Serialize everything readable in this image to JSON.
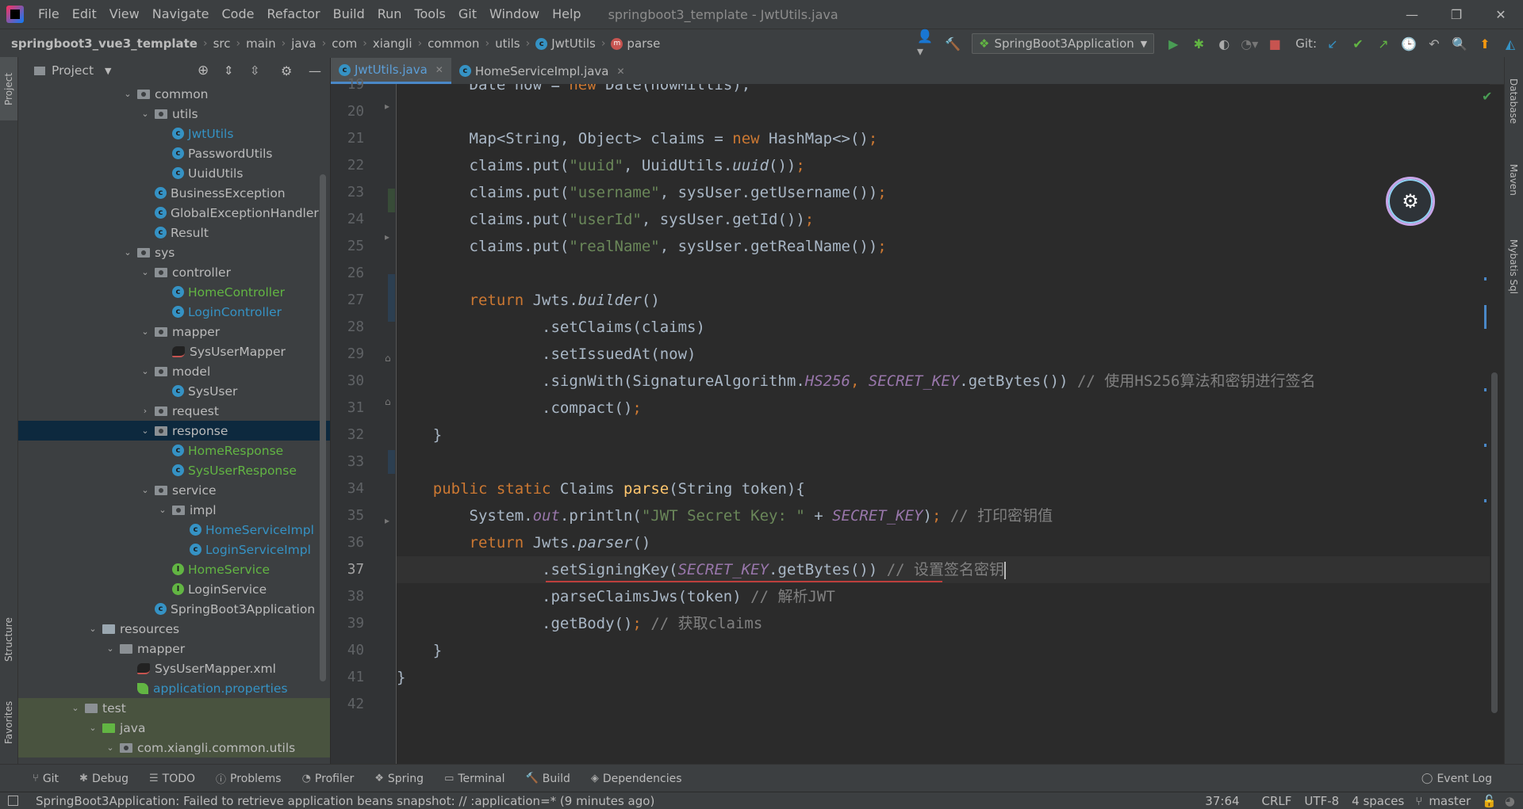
{
  "menubar": {
    "items": [
      "File",
      "Edit",
      "View",
      "Navigate",
      "Code",
      "Refactor",
      "Build",
      "Run",
      "Tools",
      "Git",
      "Window",
      "Help"
    ],
    "title": "springboot3_template - JwtUtils.java"
  },
  "breadcrumbs": [
    "springboot3_vue3_template",
    "src",
    "main",
    "java",
    "com",
    "xiangli",
    "common",
    "utils",
    "JwtUtils",
    "parse"
  ],
  "toolbar": {
    "run_config": "SpringBoot3Application",
    "git_label": "Git:"
  },
  "left_stripe": {
    "project": "Project",
    "structure": "Structure",
    "favorites": "Favorites"
  },
  "right_stripe": {
    "database": "Database",
    "maven": "Maven",
    "mybatis": "Mybatis Sql"
  },
  "project_panel": {
    "title": "Project",
    "tree": [
      {
        "label": "common",
        "type": "package",
        "indent": 0,
        "open": true
      },
      {
        "label": "utils",
        "type": "package",
        "indent": 1,
        "open": true
      },
      {
        "label": "JwtUtils",
        "type": "class",
        "indent": 2,
        "color": "blue"
      },
      {
        "label": "PasswordUtils",
        "type": "class",
        "indent": 2
      },
      {
        "label": "UuidUtils",
        "type": "class",
        "indent": 2
      },
      {
        "label": "BusinessException",
        "type": "class",
        "indent": 1
      },
      {
        "label": "GlobalExceptionHandler",
        "type": "class",
        "indent": 1
      },
      {
        "label": "Result",
        "type": "class",
        "indent": 1
      },
      {
        "label": "sys",
        "type": "package",
        "indent": 0,
        "open": true
      },
      {
        "label": "controller",
        "type": "package",
        "indent": 1,
        "open": true
      },
      {
        "label": "HomeController",
        "type": "class",
        "indent": 2,
        "color": "green"
      },
      {
        "label": "LoginController",
        "type": "class",
        "indent": 2,
        "color": "blue"
      },
      {
        "label": "mapper",
        "type": "package",
        "indent": 1,
        "open": true
      },
      {
        "label": "SysUserMapper",
        "type": "mapper",
        "indent": 2
      },
      {
        "label": "model",
        "type": "package",
        "indent": 1,
        "open": true
      },
      {
        "label": "SysUser",
        "type": "class",
        "indent": 2
      },
      {
        "label": "request",
        "type": "package",
        "indent": 1,
        "open": false
      },
      {
        "label": "response",
        "type": "package",
        "indent": 1,
        "open": true,
        "selected": true
      },
      {
        "label": "HomeResponse",
        "type": "class",
        "indent": 2,
        "color": "green"
      },
      {
        "label": "SysUserResponse",
        "type": "class",
        "indent": 2,
        "color": "green"
      },
      {
        "label": "service",
        "type": "package",
        "indent": 1,
        "open": true
      },
      {
        "label": "impl",
        "type": "package",
        "indent": 2,
        "open": true
      },
      {
        "label": "HomeServiceImpl",
        "type": "class",
        "indent": 3,
        "color": "blue"
      },
      {
        "label": "LoginServiceImpl",
        "type": "class",
        "indent": 3,
        "color": "blue"
      },
      {
        "label": "HomeService",
        "type": "interface",
        "indent": 2,
        "color": "green"
      },
      {
        "label": "LoginService",
        "type": "interface",
        "indent": 2
      },
      {
        "label": "SpringBoot3Application",
        "type": "app",
        "indent": 1
      },
      {
        "label": "resources",
        "type": "resfolder",
        "indent": -2,
        "open": true
      },
      {
        "label": "mapper",
        "type": "folder",
        "indent": -1,
        "open": true
      },
      {
        "label": "SysUserMapper.xml",
        "type": "xml",
        "indent": 0
      },
      {
        "label": "application.properties",
        "type": "props",
        "indent": 0,
        "color": "blue"
      },
      {
        "label": "test",
        "type": "folder",
        "indent": -3,
        "open": true,
        "test": true
      },
      {
        "label": "java",
        "type": "greenfolder",
        "indent": -2,
        "open": true,
        "test": true
      },
      {
        "label": "com.xiangli.common.utils",
        "type": "package",
        "indent": -1,
        "open": true,
        "test": true
      }
    ]
  },
  "editor": {
    "tabs": [
      {
        "label": "JwtUtils.java",
        "active": true
      },
      {
        "label": "HomeServiceImpl.java",
        "active": false
      }
    ],
    "first_line_number": 19,
    "current_line": 37,
    "lines": [
      [
        {
          "t": "        Date now = ",
          "c": ""
        },
        {
          "t": "new",
          "c": "kw"
        },
        {
          "t": " Date(nowMillis);",
          "c": ""
        }
      ],
      [],
      [
        {
          "t": "        Map<String, Object> claims = ",
          "c": ""
        },
        {
          "t": "new",
          "c": "kw"
        },
        {
          "t": " HashMap<>()",
          "c": ""
        },
        {
          "t": ";",
          "c": "kw"
        }
      ],
      [
        {
          "t": "        claims.put(",
          "c": ""
        },
        {
          "t": "\"uuid\"",
          "c": "str"
        },
        {
          "t": ", UuidUtils.",
          "c": ""
        },
        {
          "t": "uuid",
          "c": "it"
        },
        {
          "t": "())",
          "c": ""
        },
        {
          "t": ";",
          "c": "kw"
        }
      ],
      [
        {
          "t": "        claims.put(",
          "c": ""
        },
        {
          "t": "\"username\"",
          "c": "str"
        },
        {
          "t": ", sysUser.getUsername())",
          "c": ""
        },
        {
          "t": ";",
          "c": "kw"
        }
      ],
      [
        {
          "t": "        claims.put(",
          "c": ""
        },
        {
          "t": "\"userId\"",
          "c": "str"
        },
        {
          "t": ", sysUser.getId())",
          "c": ""
        },
        {
          "t": ";",
          "c": "kw"
        }
      ],
      [
        {
          "t": "        claims.put(",
          "c": ""
        },
        {
          "t": "\"realName\"",
          "c": "str"
        },
        {
          "t": ", sysUser.getRealName())",
          "c": ""
        },
        {
          "t": ";",
          "c": "kw"
        }
      ],
      [],
      [
        {
          "t": "        ",
          "c": ""
        },
        {
          "t": "return",
          "c": "kw"
        },
        {
          "t": " Jwts.",
          "c": ""
        },
        {
          "t": "builder",
          "c": "it"
        },
        {
          "t": "()",
          "c": ""
        }
      ],
      [
        {
          "t": "                .setClaims(claims)",
          "c": ""
        }
      ],
      [
        {
          "t": "                .setIssuedAt(now)",
          "c": ""
        }
      ],
      [
        {
          "t": "                .signWith(SignatureAlgorithm.",
          "c": ""
        },
        {
          "t": "HS256",
          "c": "const"
        },
        {
          "t": ", ",
          "c": "kw"
        },
        {
          "t": "SECRET_KEY",
          "c": "const"
        },
        {
          "t": ".getBytes()) ",
          "c": ""
        },
        {
          "t": "// 使用HS256算法和密钥进行签名",
          "c": "cmt"
        }
      ],
      [
        {
          "t": "                .compact()",
          "c": ""
        },
        {
          "t": ";",
          "c": "kw"
        }
      ],
      [
        {
          "t": "    }",
          "c": ""
        }
      ],
      [],
      [
        {
          "t": "    ",
          "c": ""
        },
        {
          "t": "public static",
          "c": "kw"
        },
        {
          "t": " Claims ",
          "c": ""
        },
        {
          "t": "parse",
          "c": "fn"
        },
        {
          "t": "(String token){",
          "c": ""
        }
      ],
      [
        {
          "t": "        System.",
          "c": ""
        },
        {
          "t": "out",
          "c": "field"
        },
        {
          "t": ".println(",
          "c": ""
        },
        {
          "t": "\"JWT Secret Key: \"",
          "c": "str"
        },
        {
          "t": " + ",
          "c": ""
        },
        {
          "t": "SECRET_KEY",
          "c": "const"
        },
        {
          "t": ")",
          "c": ""
        },
        {
          "t": ";",
          "c": "kw"
        },
        {
          "t": " // 打印密钥值",
          "c": "cmt"
        }
      ],
      [
        {
          "t": "        ",
          "c": ""
        },
        {
          "t": "return",
          "c": "kw"
        },
        {
          "t": " Jwts.",
          "c": ""
        },
        {
          "t": "parser",
          "c": "it"
        },
        {
          "t": "()",
          "c": ""
        }
      ],
      [
        {
          "t": "                .setSigningKey(",
          "c": ""
        },
        {
          "t": "SECRET_KEY",
          "c": "const"
        },
        {
          "t": ".getBytes()) ",
          "c": ""
        },
        {
          "t": "// 设置签名密钥",
          "c": "cmt"
        }
      ],
      [
        {
          "t": "                .parseClaimsJws(token) ",
          "c": ""
        },
        {
          "t": "// 解析JWT",
          "c": "cmt"
        }
      ],
      [
        {
          "t": "                .getBody()",
          "c": ""
        },
        {
          "t": ";",
          "c": "kw"
        },
        {
          "t": " // 获取claims",
          "c": "cmt"
        }
      ],
      [
        {
          "t": "    }",
          "c": ""
        }
      ],
      [
        {
          "t": "}",
          "c": ""
        }
      ],
      []
    ]
  },
  "bottom_tools": [
    "Git",
    "Debug",
    "TODO",
    "Problems",
    "Profiler",
    "Spring",
    "Terminal",
    "Build",
    "Dependencies"
  ],
  "event_log": "Event Log",
  "statusbar": {
    "message": "SpringBoot3Application: Failed to retrieve application beans snapshot: // :application=* (9 minutes ago)",
    "position": "37:64",
    "line_sep": "CRLF",
    "encoding": "UTF-8",
    "indent": "4 spaces",
    "branch": "master"
  }
}
